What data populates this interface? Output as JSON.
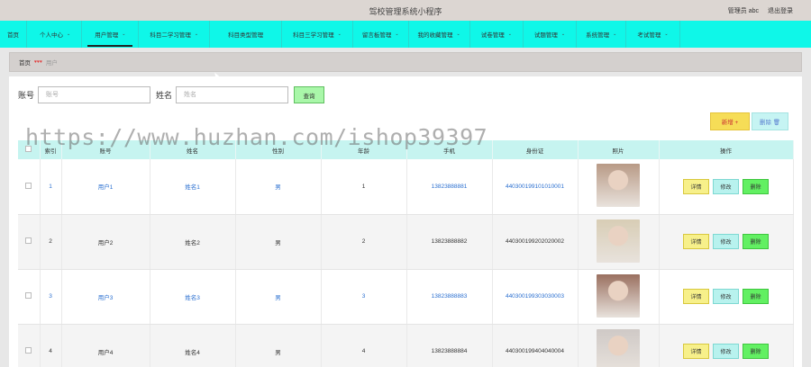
{
  "header": {
    "title": "驾校管理系统小程序",
    "user_label": "管理员 abc",
    "logout_label": "退出登录"
  },
  "nav": {
    "items": [
      {
        "label": "首页",
        "caret": false
      },
      {
        "label": "个人中心",
        "caret": true
      },
      {
        "label": "用户管理",
        "caret": true,
        "active": true
      },
      {
        "label": "科目二学习管理",
        "caret": true
      },
      {
        "label": "科目类型管理",
        "caret": false
      },
      {
        "label": "科目三学习管理",
        "caret": true
      },
      {
        "label": "留言板管理",
        "caret": true
      },
      {
        "label": "我的收藏管理",
        "caret": true
      },
      {
        "label": "试卷管理",
        "caret": true
      },
      {
        "label": "试题管理",
        "caret": true
      },
      {
        "label": "系统管理",
        "caret": true
      },
      {
        "label": "考试管理",
        "caret": true
      }
    ]
  },
  "breadcrumb": {
    "home": "首页",
    "current": "用户"
  },
  "search": {
    "account_label": "账号",
    "account_placeholder": "账号",
    "name_label": "姓名",
    "name_placeholder": "姓名",
    "query_button": "查询"
  },
  "actions": {
    "add_label": "新增 +",
    "delete_label": "删除 🗑"
  },
  "watermark": "https://www.huzhan.com/ishop39397",
  "table": {
    "headers": [
      "",
      "索引",
      "账号",
      "姓名",
      "性别",
      "年龄",
      "手机",
      "身份证",
      "照片",
      "操作"
    ],
    "rows": [
      {
        "index": "1",
        "account": "用户1",
        "name": "姓名1",
        "gender": "男",
        "age": "1",
        "phone": "13823888881",
        "id_card": "440300199101010001",
        "photo_color": "#b89a86"
      },
      {
        "index": "2",
        "account": "用户2",
        "name": "姓名2",
        "gender": "男",
        "age": "2",
        "phone": "13823888882",
        "id_card": "440300199202020002",
        "photo_color": "#d8cdb5"
      },
      {
        "index": "3",
        "account": "用户3",
        "name": "姓名3",
        "gender": "男",
        "age": "3",
        "phone": "13823888883",
        "id_card": "440300199303030003",
        "photo_color": "#9a7060"
      },
      {
        "index": "4",
        "account": "用户4",
        "name": "姓名4",
        "gender": "男",
        "age": "4",
        "phone": "13823888884",
        "id_card": "440300199404040004",
        "photo_color": "#cfc9c6"
      }
    ],
    "op_detail": "详情",
    "op_edit": "修改",
    "op_delete": "删除"
  }
}
